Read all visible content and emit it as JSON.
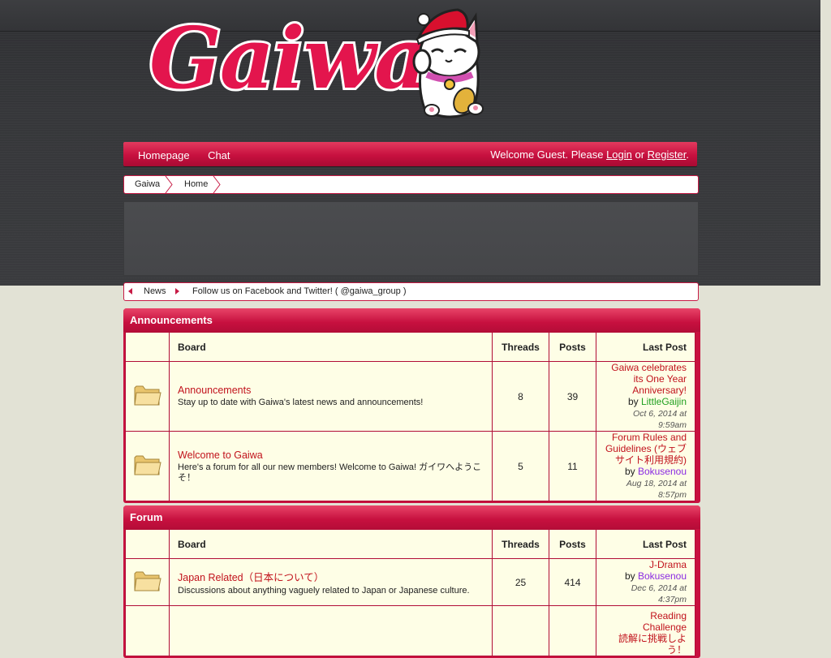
{
  "site": {
    "logo_text": "Gaiwa"
  },
  "nav": {
    "links": [
      "Homepage",
      "Chat"
    ],
    "welcome_prefix": "Welcome Guest. Please ",
    "login": "Login",
    "or": " or ",
    "register": "Register",
    "suffix": "."
  },
  "breadcrumb": [
    "Gaiwa",
    "Home"
  ],
  "news": {
    "label": "News",
    "text": "Follow us on Facebook and Twitter! ( @gaiwa_group )"
  },
  "colors": {
    "accent": "#c8113f",
    "link": "#c1121c",
    "user_green": "#20a020",
    "user_purple": "#8a2be2"
  },
  "headers": {
    "board": "Board",
    "threads": "Threads",
    "posts": "Posts",
    "last_post": "Last Post"
  },
  "categories": [
    {
      "title": "Announcements",
      "boards": [
        {
          "icon": "folder-icon",
          "name": "Announcements",
          "description": "Stay up to date with Gaiwa's latest news and announcements!",
          "threads": "8",
          "posts": "39",
          "last_post": {
            "title": "Gaiwa celebrates its One Year Anniversary!",
            "by": "by ",
            "user": "LittleGaijin",
            "date": "Oct 6, 2014 at 9:59am"
          }
        },
        {
          "icon": "folder-icon",
          "name": "Welcome to Gaiwa",
          "description": "Here's a forum for all our new members! Welcome to Gaiwa! ガイワへようこそ！",
          "threads": "5",
          "posts": "11",
          "last_post": {
            "title": "Forum Rules and Guidelines (ウェブサイト利用規約)",
            "by": "by ",
            "user": "Bokusenou",
            "date": "Aug 18, 2014 at 8:57pm"
          }
        }
      ]
    },
    {
      "title": "Forum",
      "boards": [
        {
          "icon": "folder-icon",
          "name": "Japan Related（日本について）",
          "description": "Discussions about anything vaguely related to Japan or Japanese culture.",
          "threads": "25",
          "posts": "414",
          "last_post": {
            "title": "J-Drama",
            "by": "by ",
            "user": "Bokusenou",
            "date": "Dec 6, 2014 at 4:37pm"
          }
        },
        {
          "icon": "folder-icon",
          "name": "",
          "description": "",
          "threads": "",
          "posts": "",
          "last_post": {
            "title": "Reading Challenge",
            "subtitle": "読解に挑戦しよう！",
            "by": "",
            "user": "",
            "date": ""
          }
        }
      ]
    }
  ]
}
